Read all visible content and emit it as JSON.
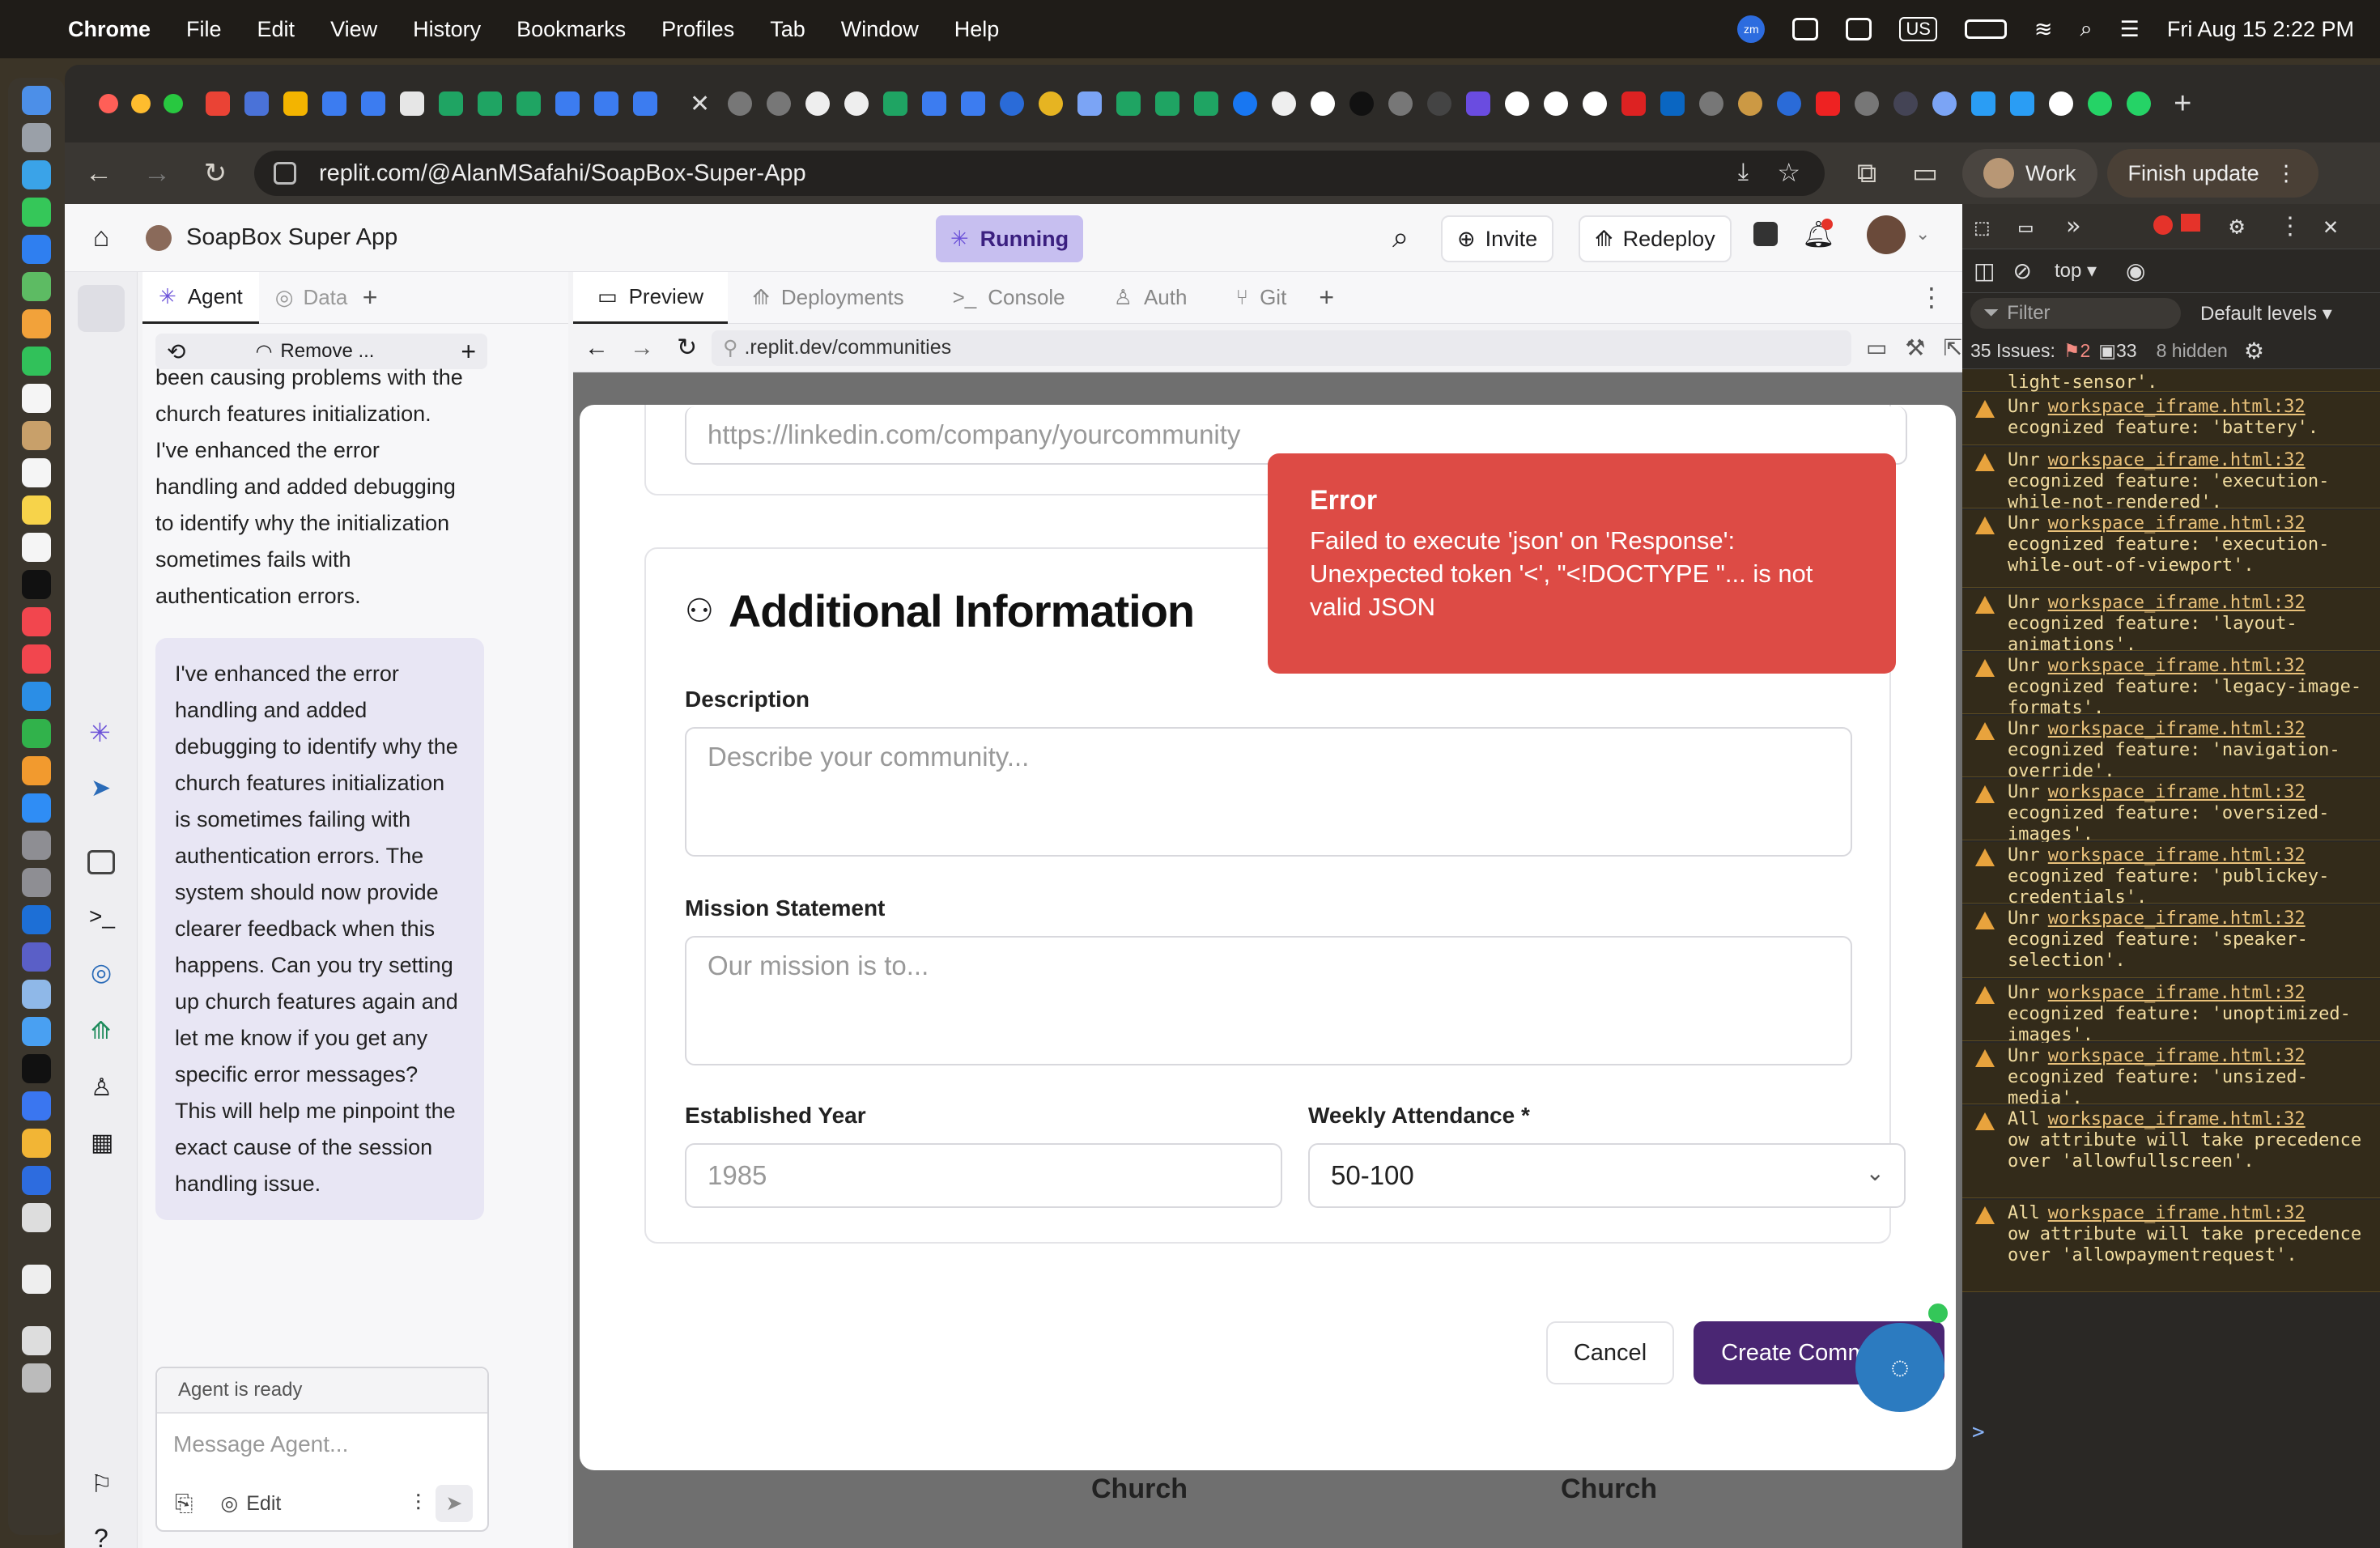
{
  "menubar": {
    "app": "Chrome",
    "items": [
      "File",
      "Edit",
      "View",
      "History",
      "Bookmarks",
      "Profiles",
      "Tab",
      "Window",
      "Help"
    ],
    "datetime": "Fri Aug 15  2:22 PM",
    "input_source": "US",
    "zoom_badge": "zm"
  },
  "browser": {
    "url": "replit.com/@AlanMSafahi/SoapBox-Super-App",
    "profile_label": "Work",
    "update_label": "Finish update"
  },
  "app": {
    "title": "SoapBox Super App",
    "status": "Running",
    "invite_label": "Invite",
    "redeploy_label": "Redeploy",
    "agent_tab": "Agent",
    "data_tab": "Data",
    "remove_label": "Remove ...",
    "preview_tabs": [
      "Preview",
      "Deployments",
      "Console",
      "Auth",
      "Git"
    ],
    "preview_url": ".replit.dev/communities"
  },
  "chat": {
    "message1": "been causing problems with the church features initialization. I've enhanced the error handling and added debugging to identify why the initialization sometimes fails with authentication errors.",
    "message2": "I've enhanced the error handling and added debugging to identify why the church features initialization is sometimes failing with authentication errors. The system should now provide clearer feedback when this happens. Can you try setting up church features again and let me know if you get any specific error messages? This will help me pinpoint the exact cause of the session handling issue.",
    "status": "Agent is ready",
    "placeholder": "Message Agent...",
    "edit_label": "Edit"
  },
  "form": {
    "linkedin_placeholder": "https://linkedin.com/company/yourcommunity",
    "section_title": "Additional Information",
    "description_label": "Description",
    "description_placeholder": "Describe your community...",
    "mission_label": "Mission Statement",
    "mission_placeholder": "Our mission is to...",
    "year_label": "Established Year",
    "year_placeholder": "1985",
    "attendance_label": "Weekly Attendance *",
    "attendance_value": "50-100",
    "cancel_label": "Cancel",
    "create_label": "Create Community",
    "bg_text_left": "Church",
    "bg_text_right": "Church"
  },
  "toast": {
    "title": "Error",
    "message": "Failed to execute 'json' on 'Response': Unexpected token '<', \"<!DOCTYPE \"... is not valid JSON"
  },
  "devtools": {
    "context": "top",
    "filter_placeholder": "Filter",
    "levels": "Default levels",
    "issues_label": "35 Issues:",
    "issues_errors": "2",
    "issues_warnings": "33",
    "hidden": "8 hidden",
    "first_line": "light-sensor'.",
    "source": "workspace_iframe.html:32",
    "logs": [
      {
        "prefix": "Unr",
        "text": "ecognized feature: 'battery'."
      },
      {
        "prefix": "Unr",
        "text": "ecognized feature: 'execution-while-not-rendered'."
      },
      {
        "prefix": "Unr",
        "text": "ecognized feature: 'execution-while-out-of-viewport'."
      },
      {
        "prefix": "Unr",
        "text": "ecognized feature: 'layout-animations'."
      },
      {
        "prefix": "Unr",
        "text": "ecognized feature: 'legacy-image-formats'."
      },
      {
        "prefix": "Unr",
        "text": "ecognized feature: 'navigation-override'."
      },
      {
        "prefix": "Unr",
        "text": "ecognized feature: 'oversized-images'."
      },
      {
        "prefix": "Unr",
        "text": "ecognized feature: 'publickey-credentials'."
      },
      {
        "prefix": "Unr",
        "text": "ecognized feature: 'speaker-selection'."
      },
      {
        "prefix": "Unr",
        "text": "ecognized feature: 'unoptimized-images'."
      },
      {
        "prefix": "Unr",
        "text": "ecognized feature: 'unsized-media'."
      },
      {
        "prefix": "All",
        "text": "ow attribute will take precedence over 'allowfullscreen'."
      },
      {
        "prefix": "All",
        "text": "ow attribute will take precedence over 'allowpaymentrequest'."
      }
    ],
    "prompt": ">"
  },
  "colors": {
    "accent": "#4a2673",
    "error": "#dd4b45",
    "running": "#c7bff0"
  }
}
